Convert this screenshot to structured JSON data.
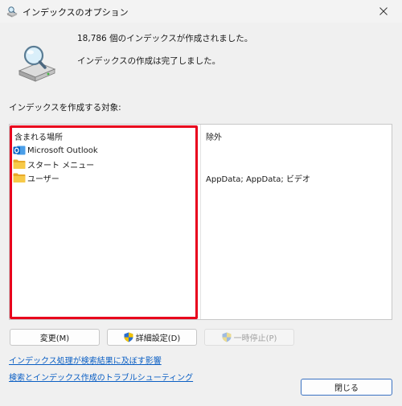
{
  "window": {
    "title": "インデックスのオプション"
  },
  "status": {
    "line1": "18,786 個のインデックスが作成されました。",
    "line2": "インデックスの作成は完了しました。"
  },
  "locations": {
    "section_label": "インデックスを作成する対象:",
    "header_included": "含まれる場所",
    "header_excluded": "除外",
    "rows": [
      {
        "label": "Microsoft Outlook",
        "icon": "outlook-icon",
        "excluded": ""
      },
      {
        "label": "スタート メニュー",
        "icon": "folder-icon",
        "excluded": ""
      },
      {
        "label": "ユーザー",
        "icon": "folder-icon",
        "excluded": "AppData; AppData; ビデオ"
      }
    ]
  },
  "buttons": {
    "modify": "変更(M)",
    "advanced": "詳細設定(D)",
    "pause": "一時停止(P)",
    "close": "閉じる"
  },
  "links": {
    "how_indexing_affects": "インデックス処理が検索結果に及ぼす影響",
    "troubleshoot": "検索とインデックス作成のトラブルシューティング"
  },
  "colors": {
    "highlight": "#e8001c",
    "link": "#0b5fc4",
    "folder": "#f5c342",
    "outlook": "#0a64c4"
  }
}
